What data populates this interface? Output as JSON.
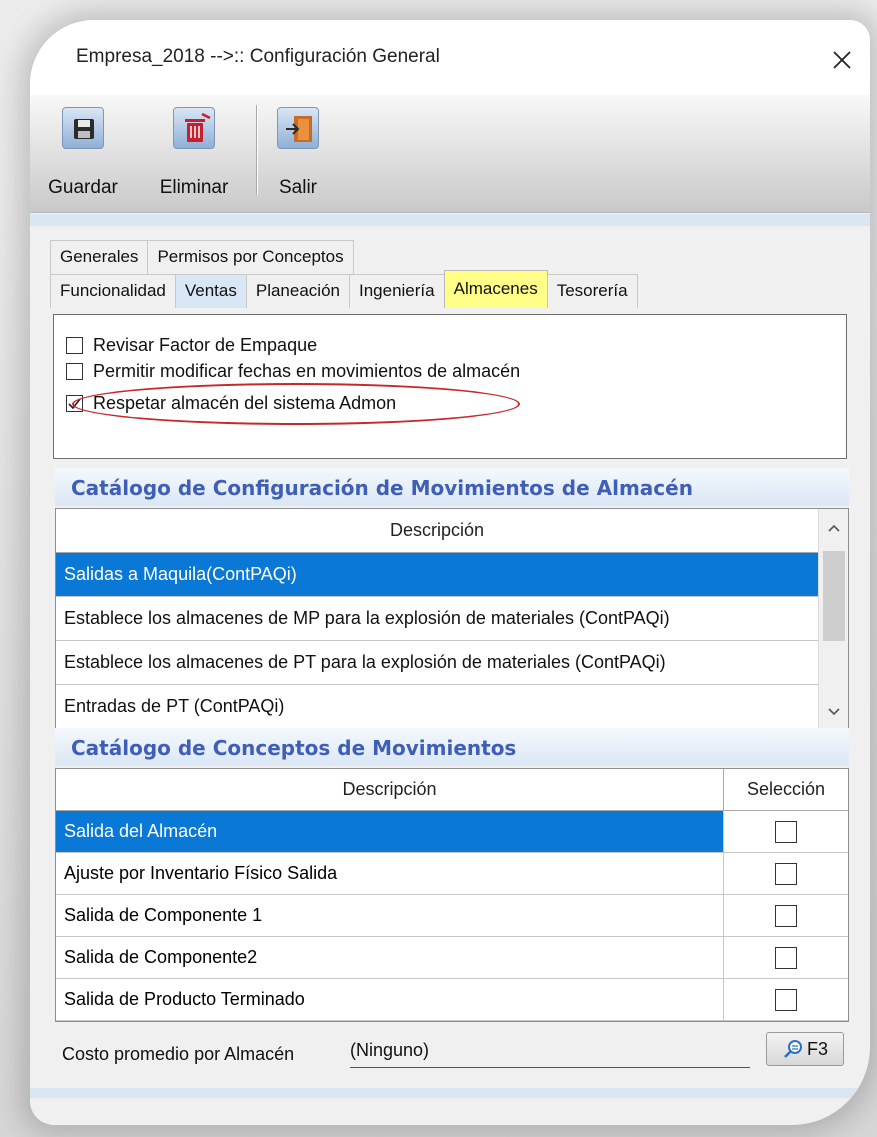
{
  "window": {
    "title": "Empresa_2018 -->:: Configuración General",
    "close_icon": "close-icon"
  },
  "toolbar": {
    "save_label": "Guardar",
    "delete_label": "Eliminar",
    "exit_label": "Salir",
    "icons": [
      "floppy-disk-icon",
      "trash-icon",
      "exit-door-icon"
    ]
  },
  "tabs": {
    "row1": [
      "Generales",
      "Permisos por Conceptos"
    ],
    "row2": [
      "Funcionalidad",
      "Ventas",
      "Planeación",
      "Ingeniería",
      "Almacenes",
      "Tesorería"
    ],
    "active": "Almacenes"
  },
  "options": [
    {
      "label": "Revisar Factor de Empaque",
      "checked": false
    },
    {
      "label": "Permitir modificar fechas en movimientos de almacén",
      "checked": false
    },
    {
      "label": "Respetar almacén del sistema Admon",
      "checked": true,
      "highlighted": true
    }
  ],
  "movimientos": {
    "title": "Catálogo de Configuración de Movimientos de Almacén",
    "column": "Descripción",
    "rows": [
      "Salidas a Maquila(ContPAQi)",
      "Establece los almacenes de MP para la explosión de materiales (ContPAQi)",
      "Establece los almacenes de PT para la explosión de materiales (ContPAQi)",
      "Entradas de PT (ContPAQi)"
    ],
    "selected_index": 0
  },
  "conceptos": {
    "title": "Catálogo de Conceptos de Movimientos",
    "columns": [
      "Descripción",
      "Selección"
    ],
    "rows": [
      {
        "descripcion": "Salida del Almacén",
        "seleccion": false
      },
      {
        "descripcion": "Ajuste por Inventario Físico Salida",
        "seleccion": false
      },
      {
        "descripcion": "Salida de Componente 1",
        "seleccion": false
      },
      {
        "descripcion": "Salida de Componente2",
        "seleccion": false
      },
      {
        "descripcion": "Salida de Producto Terminado",
        "seleccion": false
      }
    ],
    "selected_index": 0
  },
  "costo": {
    "label": "Costo promedio por Almacén",
    "value": "(Ninguno)",
    "button_label": "F3",
    "button_icon": "search-icon"
  },
  "colors": {
    "selection": "#0a78d7",
    "active_tab": "#ffff88",
    "section_title": "#3f5fb7",
    "highlight_ellipse": "#c8282d"
  }
}
